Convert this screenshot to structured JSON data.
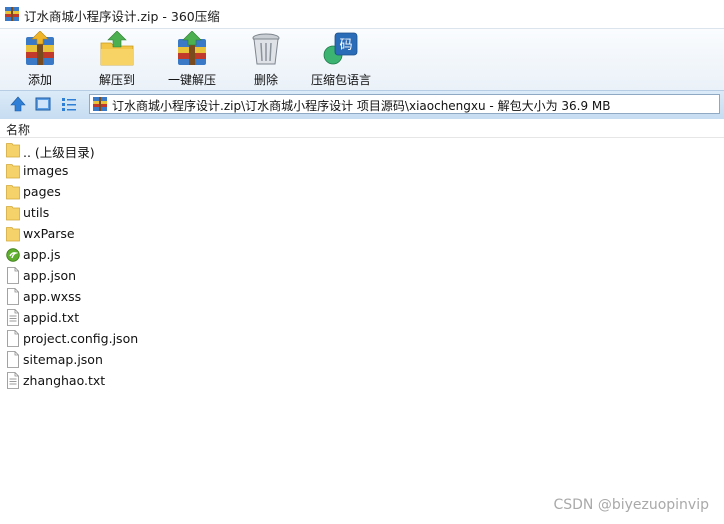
{
  "window": {
    "title": "订水商城小程序设计.zip - 360压缩"
  },
  "toolbar": {
    "add_label": "添加",
    "extract_label": "解压到",
    "one_click_label": "一键解压",
    "delete_label": "删除",
    "language_label": "压缩包语言",
    "language_icon_char": "码"
  },
  "address": {
    "path": "订水商城小程序设计.zip\\订水商城小程序设计 项目源码\\xiaochengxu - 解包大小为 36.9 MB"
  },
  "columns": {
    "name": "名称"
  },
  "files": [
    {
      "name": ".. (上级目录)",
      "icon": "folder-icon"
    },
    {
      "name": "images",
      "icon": "folder-icon"
    },
    {
      "name": "pages",
      "icon": "folder-icon"
    },
    {
      "name": "utils",
      "icon": "folder-icon"
    },
    {
      "name": "wxParse",
      "icon": "folder-icon"
    },
    {
      "name": "app.js",
      "icon": "javascript-file-icon"
    },
    {
      "name": "app.json",
      "icon": "file-icon"
    },
    {
      "name": "app.wxss",
      "icon": "file-icon"
    },
    {
      "name": "appid.txt",
      "icon": "text-file-icon"
    },
    {
      "name": "project.config.json",
      "icon": "file-icon"
    },
    {
      "name": "sitemap.json",
      "icon": "file-icon"
    },
    {
      "name": "zhanghao.txt",
      "icon": "text-file-icon"
    }
  ],
  "watermark": "CSDN @biyezuopinvip",
  "colors": {
    "toolbar_bg": "#eaf1f8",
    "addressbar_bg": "#c6dcf1",
    "folder": "#f6d36a",
    "accent": "#2b6cb8"
  }
}
